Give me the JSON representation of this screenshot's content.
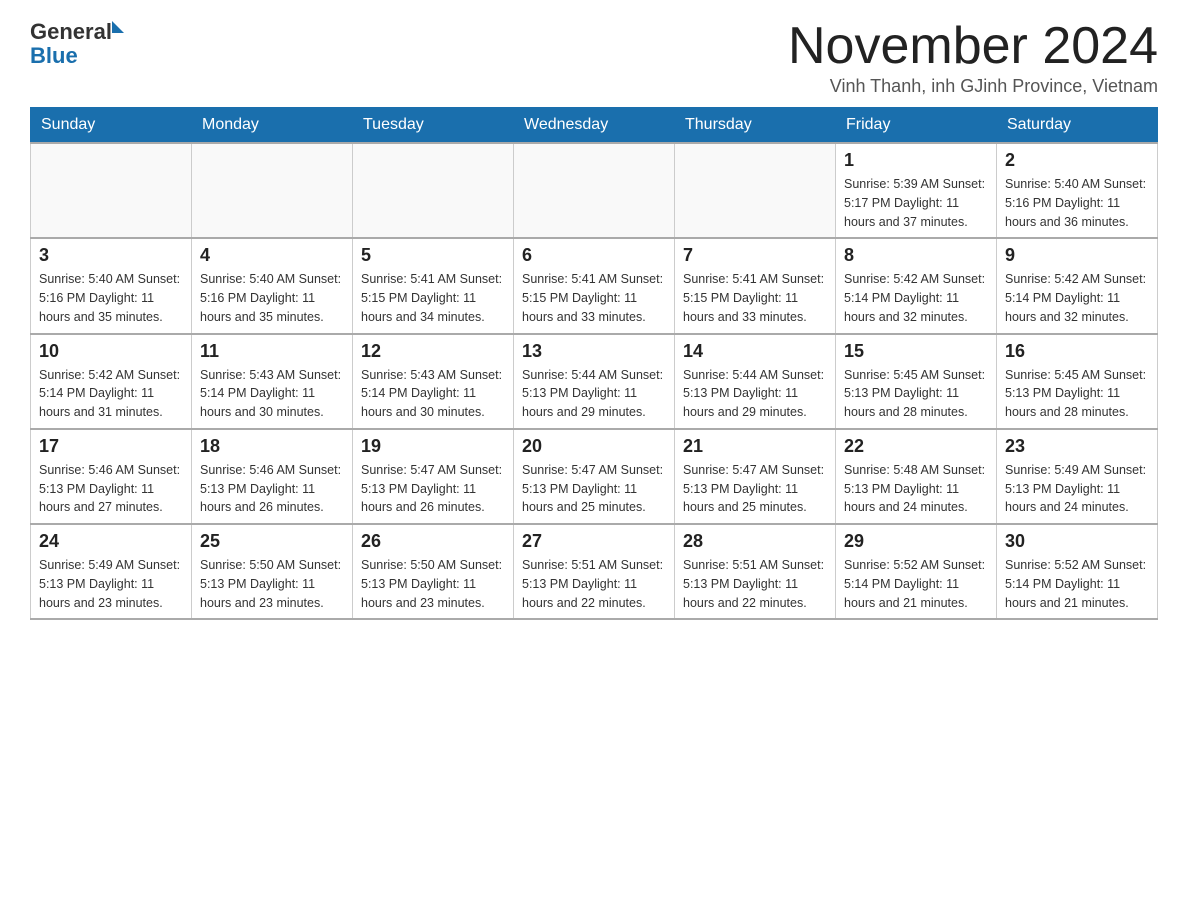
{
  "header": {
    "logo_general": "General",
    "logo_blue": "Blue",
    "title": "November 2024",
    "location": "Vinh Thanh, inh GJinh Province, Vietnam"
  },
  "days_of_week": [
    "Sunday",
    "Monday",
    "Tuesday",
    "Wednesday",
    "Thursday",
    "Friday",
    "Saturday"
  ],
  "weeks": [
    [
      {
        "day": "",
        "info": ""
      },
      {
        "day": "",
        "info": ""
      },
      {
        "day": "",
        "info": ""
      },
      {
        "day": "",
        "info": ""
      },
      {
        "day": "",
        "info": ""
      },
      {
        "day": "1",
        "info": "Sunrise: 5:39 AM\nSunset: 5:17 PM\nDaylight: 11 hours\nand 37 minutes."
      },
      {
        "day": "2",
        "info": "Sunrise: 5:40 AM\nSunset: 5:16 PM\nDaylight: 11 hours\nand 36 minutes."
      }
    ],
    [
      {
        "day": "3",
        "info": "Sunrise: 5:40 AM\nSunset: 5:16 PM\nDaylight: 11 hours\nand 35 minutes."
      },
      {
        "day": "4",
        "info": "Sunrise: 5:40 AM\nSunset: 5:16 PM\nDaylight: 11 hours\nand 35 minutes."
      },
      {
        "day": "5",
        "info": "Sunrise: 5:41 AM\nSunset: 5:15 PM\nDaylight: 11 hours\nand 34 minutes."
      },
      {
        "day": "6",
        "info": "Sunrise: 5:41 AM\nSunset: 5:15 PM\nDaylight: 11 hours\nand 33 minutes."
      },
      {
        "day": "7",
        "info": "Sunrise: 5:41 AM\nSunset: 5:15 PM\nDaylight: 11 hours\nand 33 minutes."
      },
      {
        "day": "8",
        "info": "Sunrise: 5:42 AM\nSunset: 5:14 PM\nDaylight: 11 hours\nand 32 minutes."
      },
      {
        "day": "9",
        "info": "Sunrise: 5:42 AM\nSunset: 5:14 PM\nDaylight: 11 hours\nand 32 minutes."
      }
    ],
    [
      {
        "day": "10",
        "info": "Sunrise: 5:42 AM\nSunset: 5:14 PM\nDaylight: 11 hours\nand 31 minutes."
      },
      {
        "day": "11",
        "info": "Sunrise: 5:43 AM\nSunset: 5:14 PM\nDaylight: 11 hours\nand 30 minutes."
      },
      {
        "day": "12",
        "info": "Sunrise: 5:43 AM\nSunset: 5:14 PM\nDaylight: 11 hours\nand 30 minutes."
      },
      {
        "day": "13",
        "info": "Sunrise: 5:44 AM\nSunset: 5:13 PM\nDaylight: 11 hours\nand 29 minutes."
      },
      {
        "day": "14",
        "info": "Sunrise: 5:44 AM\nSunset: 5:13 PM\nDaylight: 11 hours\nand 29 minutes."
      },
      {
        "day": "15",
        "info": "Sunrise: 5:45 AM\nSunset: 5:13 PM\nDaylight: 11 hours\nand 28 minutes."
      },
      {
        "day": "16",
        "info": "Sunrise: 5:45 AM\nSunset: 5:13 PM\nDaylight: 11 hours\nand 28 minutes."
      }
    ],
    [
      {
        "day": "17",
        "info": "Sunrise: 5:46 AM\nSunset: 5:13 PM\nDaylight: 11 hours\nand 27 minutes."
      },
      {
        "day": "18",
        "info": "Sunrise: 5:46 AM\nSunset: 5:13 PM\nDaylight: 11 hours\nand 26 minutes."
      },
      {
        "day": "19",
        "info": "Sunrise: 5:47 AM\nSunset: 5:13 PM\nDaylight: 11 hours\nand 26 minutes."
      },
      {
        "day": "20",
        "info": "Sunrise: 5:47 AM\nSunset: 5:13 PM\nDaylight: 11 hours\nand 25 minutes."
      },
      {
        "day": "21",
        "info": "Sunrise: 5:47 AM\nSunset: 5:13 PM\nDaylight: 11 hours\nand 25 minutes."
      },
      {
        "day": "22",
        "info": "Sunrise: 5:48 AM\nSunset: 5:13 PM\nDaylight: 11 hours\nand 24 minutes."
      },
      {
        "day": "23",
        "info": "Sunrise: 5:49 AM\nSunset: 5:13 PM\nDaylight: 11 hours\nand 24 minutes."
      }
    ],
    [
      {
        "day": "24",
        "info": "Sunrise: 5:49 AM\nSunset: 5:13 PM\nDaylight: 11 hours\nand 23 minutes."
      },
      {
        "day": "25",
        "info": "Sunrise: 5:50 AM\nSunset: 5:13 PM\nDaylight: 11 hours\nand 23 minutes."
      },
      {
        "day": "26",
        "info": "Sunrise: 5:50 AM\nSunset: 5:13 PM\nDaylight: 11 hours\nand 23 minutes."
      },
      {
        "day": "27",
        "info": "Sunrise: 5:51 AM\nSunset: 5:13 PM\nDaylight: 11 hours\nand 22 minutes."
      },
      {
        "day": "28",
        "info": "Sunrise: 5:51 AM\nSunset: 5:13 PM\nDaylight: 11 hours\nand 22 minutes."
      },
      {
        "day": "29",
        "info": "Sunrise: 5:52 AM\nSunset: 5:14 PM\nDaylight: 11 hours\nand 21 minutes."
      },
      {
        "day": "30",
        "info": "Sunrise: 5:52 AM\nSunset: 5:14 PM\nDaylight: 11 hours\nand 21 minutes."
      }
    ]
  ]
}
